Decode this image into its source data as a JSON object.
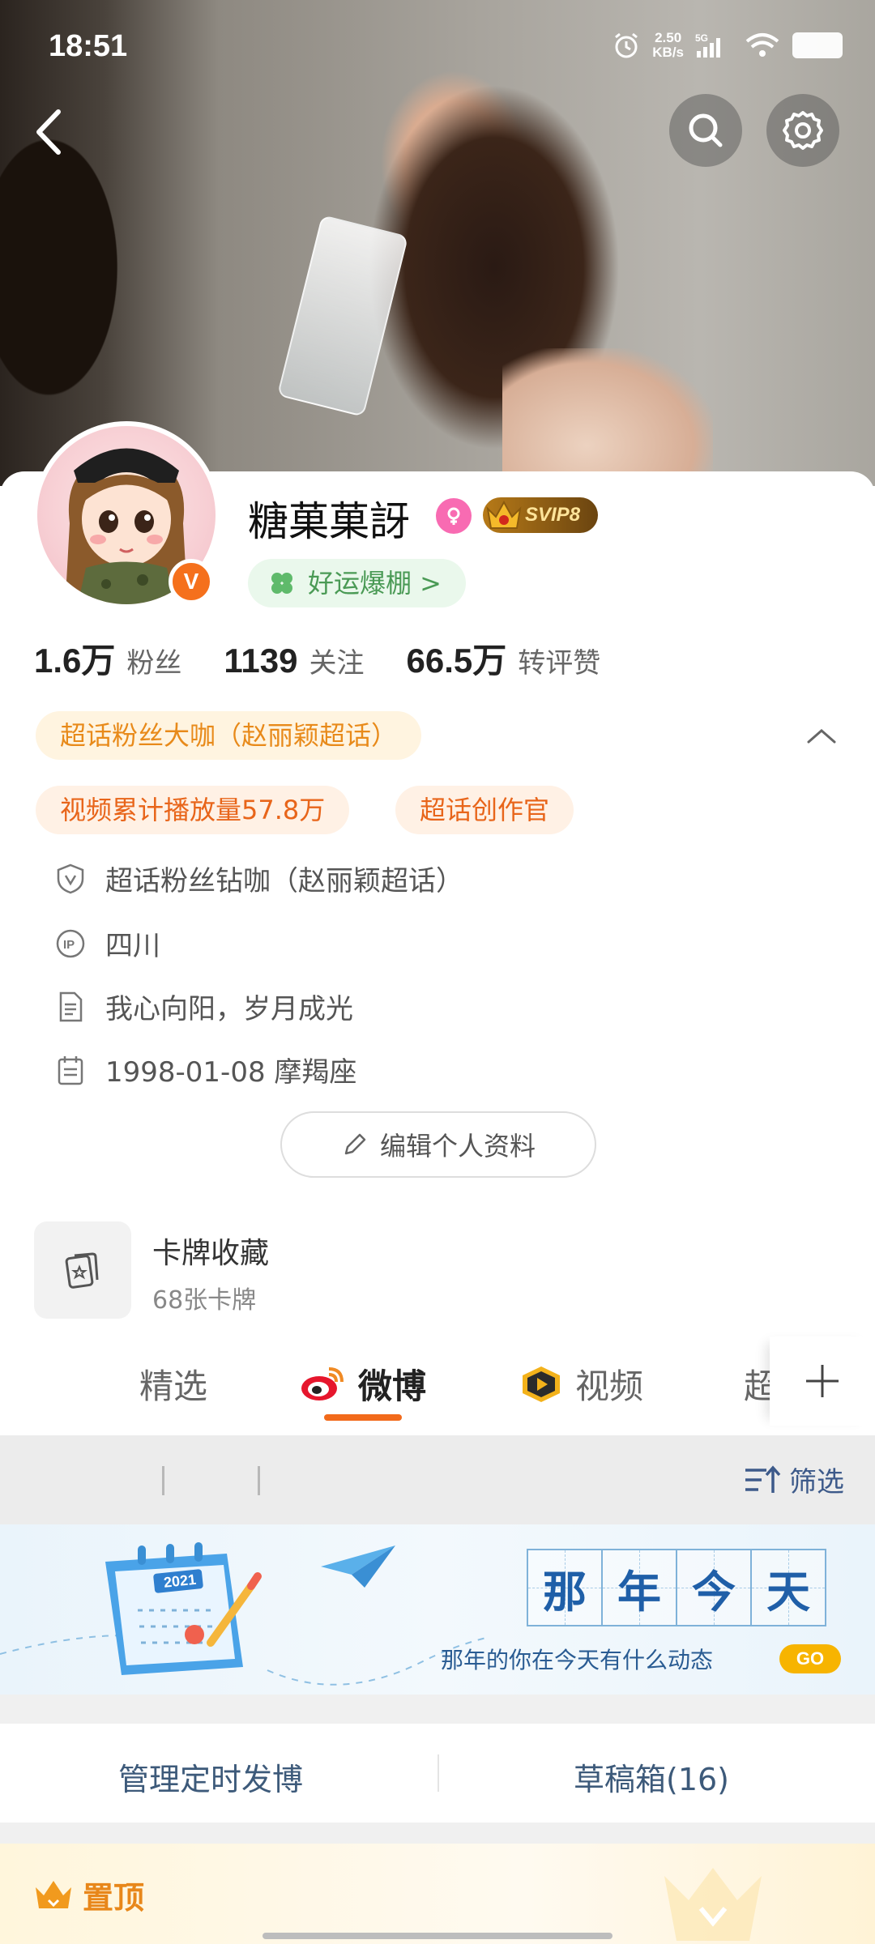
{
  "status_bar": {
    "time": "18:51",
    "net_speed_value": "2.50",
    "net_speed_unit": "KB/s",
    "network": "5G"
  },
  "profile": {
    "name": "糖菓菓訝",
    "vip_badge": "SVIP8",
    "luck_chip": "好运爆棚 >",
    "verified_mark": "V",
    "stats": [
      {
        "value": "1.6万",
        "label": "粉丝"
      },
      {
        "value": "1139",
        "label": "关注"
      },
      {
        "value": "66.5万",
        "label": "转评赞"
      }
    ],
    "tags": {
      "superfan": "超话粉丝大咖（赵丽颖超话）",
      "views": "视频累计播放量57.8万",
      "creator": "超话创作官"
    },
    "info": {
      "fan_level": "超话粉丝钻咖（赵丽颖超话）",
      "ip": "四川",
      "bio": "我心向阳，岁月成光",
      "birthday": "1998-01-08 摩羯座"
    },
    "edit_button": "编辑个人资料",
    "cards": {
      "title": "卡牌收藏",
      "subtitle": "68张卡牌"
    }
  },
  "tabs": {
    "items": [
      {
        "label": "精选"
      },
      {
        "label": "微博"
      },
      {
        "label": "视频"
      },
      {
        "label": "超"
      }
    ],
    "active": "微博"
  },
  "filter": {
    "label": "筛选"
  },
  "banner": {
    "title_chars": [
      "那",
      "年",
      "今",
      "天"
    ],
    "subtitle": "那年的你在今天有什么动态",
    "go_label": "GO",
    "calendar_year": "2021"
  },
  "manage": {
    "schedule": "管理定时发博",
    "drafts": "草稿箱(16)"
  },
  "pinned": {
    "label": "置顶"
  },
  "colors": {
    "accent_orange": "#f26a1b",
    "tag_orange_bg": "#fff1e5",
    "link_blue": "#3d5a8a",
    "svip_gold": "#b77a18"
  }
}
